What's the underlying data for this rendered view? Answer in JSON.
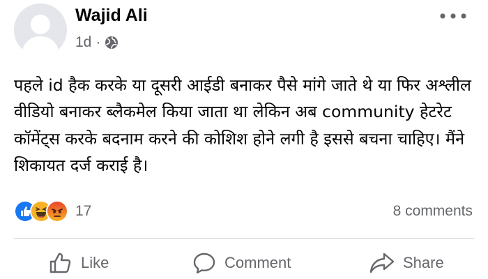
{
  "post": {
    "author": "Wajid Ali",
    "time": "1d",
    "separator": "·",
    "text": "पहले id हैक करके या दूसरी आईडी बनाकर पैसे मांगे जाते थे या फिर अश्लील वीडियो बनाकर ब्लैकमेल किया जाता था लेकिन अब community हेटरेट कॉमेंट्स करके बदनाम करने की कोशिश होने लगी है इससे बचना चाहिए। मैंने शिकायत दर्ज कराई है।"
  },
  "stats": {
    "reaction_count": "17",
    "reactions": [
      "like-icon",
      "haha-icon",
      "angry-icon"
    ],
    "comments": "8 comments"
  },
  "actions": {
    "like": "Like",
    "comment": "Comment",
    "share": "Share"
  },
  "colors": {
    "like_blue": "#1877f2",
    "reaction_yellow": "#f7b125",
    "angry_orange": "#e9710f",
    "secondary_text": "#65676b",
    "divider": "#ced0d4"
  },
  "icons": {
    "privacy": "globe-icon",
    "more": "more-horizontal-icon"
  }
}
